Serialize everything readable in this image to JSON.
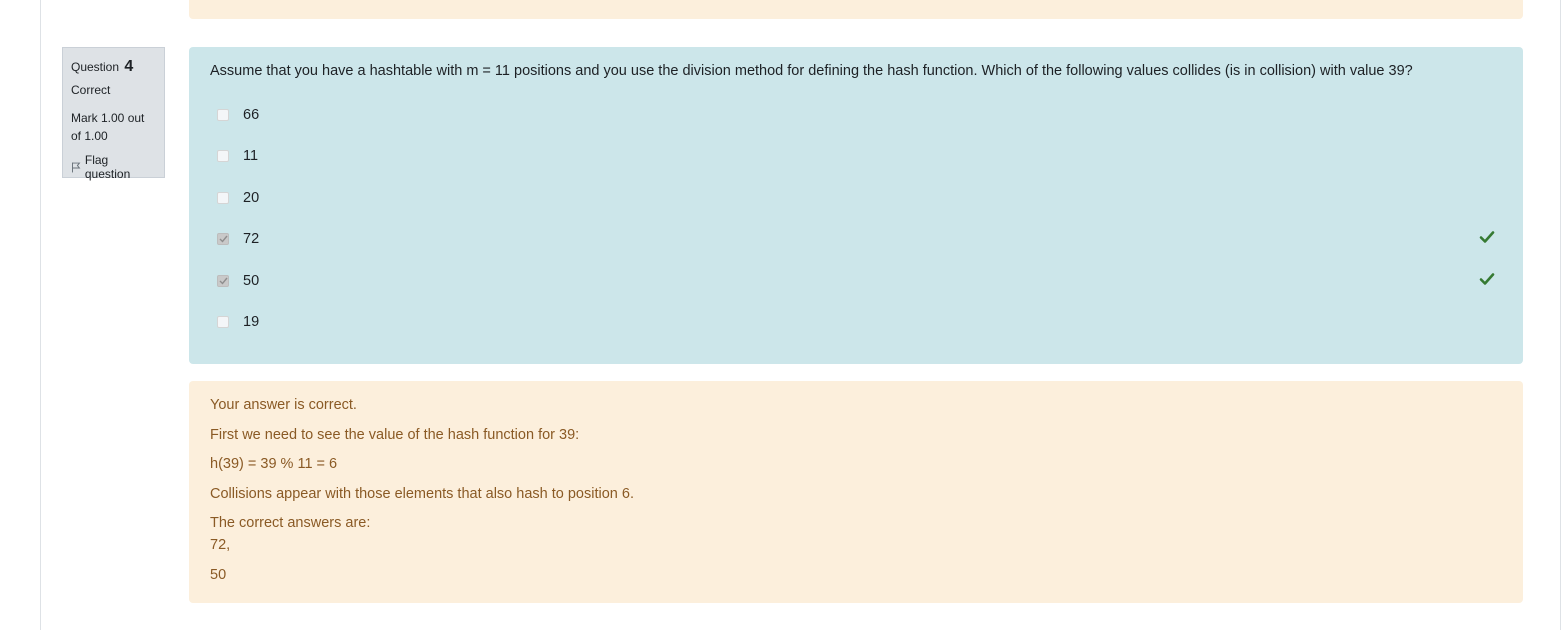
{
  "question": {
    "label": "Question",
    "number": "4",
    "state": "Correct",
    "grade": "Mark 1.00 out of 1.00",
    "flag_label": "Flag question",
    "text": "Assume that you have a hashtable with m = 11 positions and you use the division method for defining the hash function. Which of the following values collides (is in collision) with value 39?",
    "options": [
      {
        "label": "66",
        "checked": false,
        "correct_mark": false
      },
      {
        "label": "11",
        "checked": false,
        "correct_mark": false
      },
      {
        "label": "20",
        "checked": false,
        "correct_mark": false
      },
      {
        "label": "72",
        "checked": true,
        "correct_mark": true
      },
      {
        "label": "50",
        "checked": true,
        "correct_mark": true
      },
      {
        "label": "19",
        "checked": false,
        "correct_mark": false
      }
    ]
  },
  "feedback": {
    "status": "Your answer is correct.",
    "line1": "First we need to see the value of the hash function for 39:",
    "line2": "h(39) = 39 % 11 = 6",
    "line3": "Collisions appear with those elements that also hash to position 6.",
    "right_answer_label": "The correct answers are:",
    "answer1": "72,",
    "answer2": "50"
  },
  "colors": {
    "question_bg": "#cce6ea",
    "feedback_bg": "#fcefdc",
    "feedback_text": "#8a5a25",
    "tick": "#357a32",
    "info_bg": "#dee2e6"
  }
}
